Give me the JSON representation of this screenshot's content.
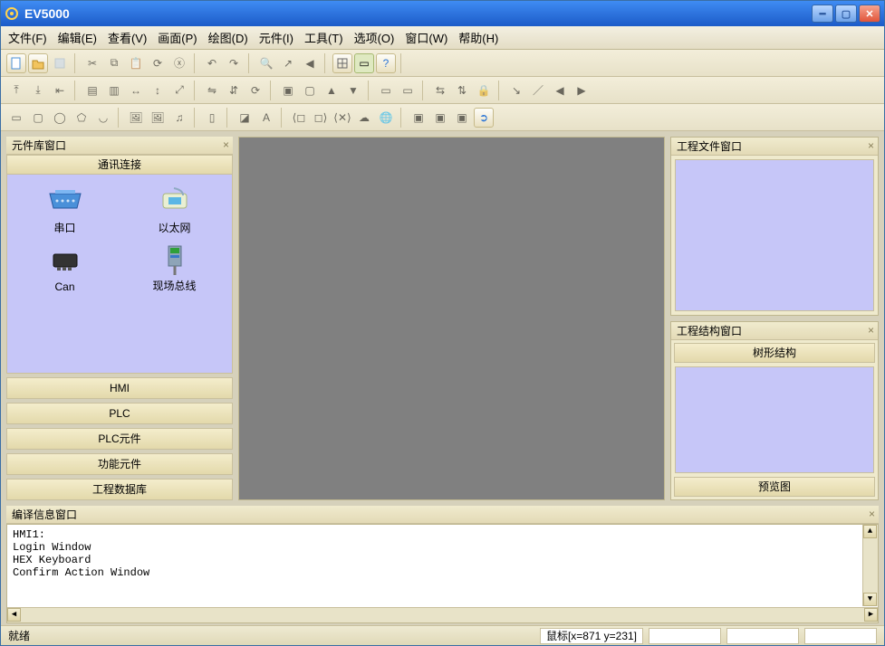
{
  "title": "EV5000",
  "menu": {
    "file": "文件(F)",
    "edit": "编辑(E)",
    "view": "查看(V)",
    "screen": "画面(P)",
    "draw": "绘图(D)",
    "element": "元件(I)",
    "tools": "工具(T)",
    "options": "选项(O)",
    "window": "窗口(W)",
    "help": "帮助(H)"
  },
  "left": {
    "title": "元件库窗口",
    "tab_active": "通讯连接",
    "items": {
      "serial": "串口",
      "ethernet": "以太网",
      "can": "Can",
      "fieldbus": "现场总线"
    },
    "stack": [
      "HMI",
      "PLC",
      "PLC元件",
      "功能元件",
      "工程数据库"
    ]
  },
  "right": {
    "project_files": "工程文件窗口",
    "project_struct": "工程结构窗口",
    "tree_tab": "树形结构",
    "preview": "预览图"
  },
  "bottom": {
    "title": "编译信息窗口",
    "lines": [
      "HMI1:",
      "Login Window",
      "HEX Keyboard",
      "Confirm Action Window"
    ]
  },
  "status": {
    "ready": "就绪",
    "mouse": "鼠标[x=871 y=231]"
  }
}
